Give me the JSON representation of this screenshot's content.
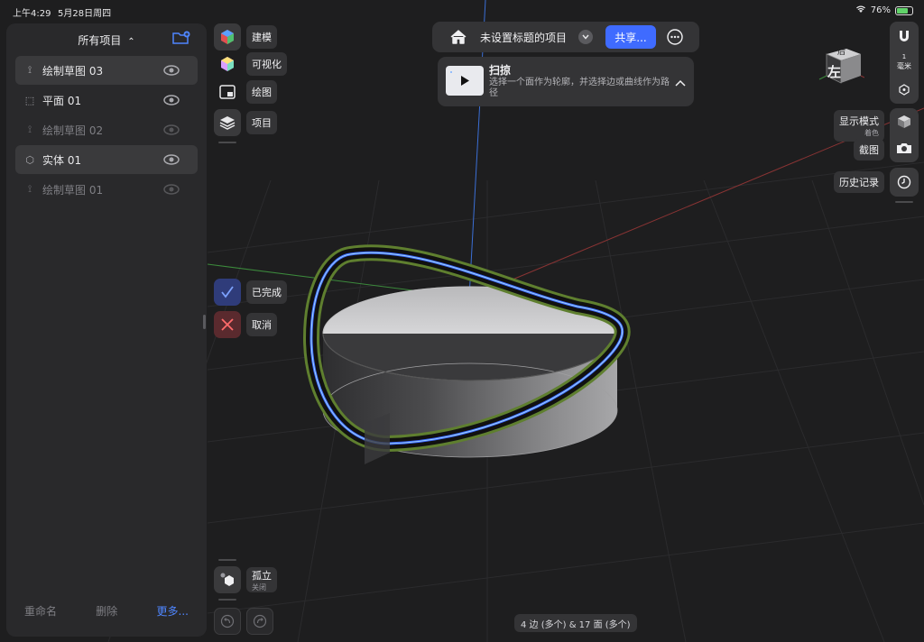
{
  "status_bar": {
    "time": "上午4:29",
    "date": "5月28日周四",
    "battery": "76%",
    "battery_level": 0.76
  },
  "left_panel": {
    "title": "所有项目",
    "title_chevron": "⌃",
    "items": [
      {
        "label": "绘制草图 03",
        "icon": "sketch-icon",
        "state": "selected"
      },
      {
        "label": "平面  01",
        "icon": "plane-icon",
        "state": "normal"
      },
      {
        "label": "绘制草图 02",
        "icon": "sketch-icon",
        "state": "dim"
      },
      {
        "label": "实体  01",
        "icon": "body-icon",
        "state": "selected"
      },
      {
        "label": "绘制草图 01",
        "icon": "sketch-icon",
        "state": "dim"
      }
    ],
    "footer": {
      "rename": "重命名",
      "delete": "删除",
      "more": "更多..."
    }
  },
  "tools": {
    "modeling": "建模",
    "visualize": "可视化",
    "drawing": "绘图",
    "project": "项目",
    "done": "已完成",
    "cancel": "取消",
    "isolate": "孤立",
    "isolate_state": "关闭"
  },
  "top_bar": {
    "title": "未设置标题的项目",
    "share": "共享..."
  },
  "sweep": {
    "title": "扫掠",
    "description": "选择一个面作为轮廓，并选择边或曲线作为路径"
  },
  "right_toolbar": {
    "units_num": "1",
    "units": "毫米",
    "view_cube_label": "左",
    "view_cube_top": "后",
    "display_mode": "显示模式",
    "display_mode_value": "着色",
    "screenshot": "截图",
    "history": "历史记录"
  },
  "selection_status": "4 边 (多个) & 17 面 (多个)",
  "colors": {
    "accent": "#3f6bff",
    "panel": "#29292b",
    "button": "#3a3a3c",
    "done": "#2f3c7a",
    "cancel": "#5a2a2e"
  }
}
